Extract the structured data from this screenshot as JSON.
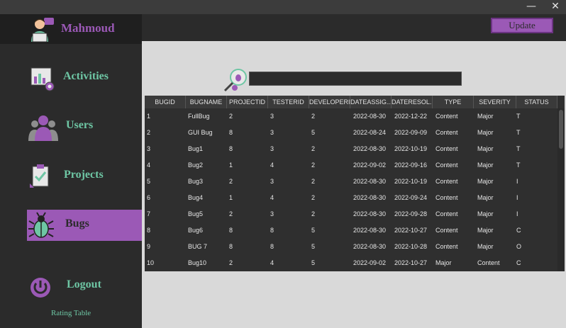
{
  "window": {
    "minimize": "—",
    "close": "✕"
  },
  "profile": {
    "name": "Mahmoud",
    "avatar_icon": "developer-avatar-icon"
  },
  "nav": [
    {
      "label": "Activities",
      "icon": "activities-chart-icon",
      "active": false
    },
    {
      "label": "Users",
      "icon": "users-icon",
      "active": false
    },
    {
      "label": "Projects",
      "icon": "projects-clipboard-icon",
      "active": false
    },
    {
      "label": "Bugs",
      "icon": "bug-icon",
      "active": true
    },
    {
      "label": "Logout",
      "icon": "power-icon",
      "active": false
    }
  ],
  "rating_label": "Rating Table",
  "update_label": "Update",
  "search": {
    "icon": "bug-search-icon",
    "value": ""
  },
  "table": {
    "columns": [
      "BUGID",
      "BUGNAME",
      "PROJECTID",
      "TESTERID",
      "DEVELOPERID",
      "DATEASSIG...",
      "DATERESOL...",
      "TYPE",
      "SEVERITY",
      "STATUS"
    ],
    "rows": [
      [
        "1",
        "FullBug",
        "2",
        "3",
        "2",
        "2022-08-30",
        "2022-12-22",
        "Content",
        "Major",
        "T"
      ],
      [
        "2",
        "GUI Bug",
        "8",
        "3",
        "5",
        "2022-08-24",
        "2022-09-09",
        "Content",
        "Major",
        "T"
      ],
      [
        "3",
        "Bug1",
        "8",
        "3",
        "2",
        "2022-08-30",
        "2022-10-19",
        "Content",
        "Major",
        "T"
      ],
      [
        "4",
        "Bug2",
        "1",
        "4",
        "2",
        "2022-09-02",
        "2022-09-16",
        "Content",
        "Major",
        "T"
      ],
      [
        "5",
        "Bug3",
        "2",
        "3",
        "2",
        "2022-08-30",
        "2022-10-19",
        "Content",
        "Major",
        "I"
      ],
      [
        "6",
        "Bug4",
        "1",
        "4",
        "2",
        "2022-08-30",
        "2022-09-24",
        "Content",
        "Major",
        "I"
      ],
      [
        "7",
        "Bug5",
        "2",
        "3",
        "2",
        "2022-08-30",
        "2022-09-28",
        "Content",
        "Major",
        "I"
      ],
      [
        "8",
        "Bug6",
        "8",
        "8",
        "5",
        "2022-08-30",
        "2022-10-27",
        "Content",
        "Major",
        "C"
      ],
      [
        "9",
        "BUG 7",
        "8",
        "8",
        "5",
        "2022-08-30",
        "2022-10-28",
        "Content",
        "Major",
        "O"
      ],
      [
        "10",
        "Bug10",
        "2",
        "4",
        "5",
        "2022-09-02",
        "2022-10-27",
        "Major",
        "Content",
        "C"
      ]
    ]
  },
  "colors": {
    "accent": "#9b59b6",
    "nav_text": "#6ec6a4",
    "sidebar": "#2b2b2b"
  }
}
